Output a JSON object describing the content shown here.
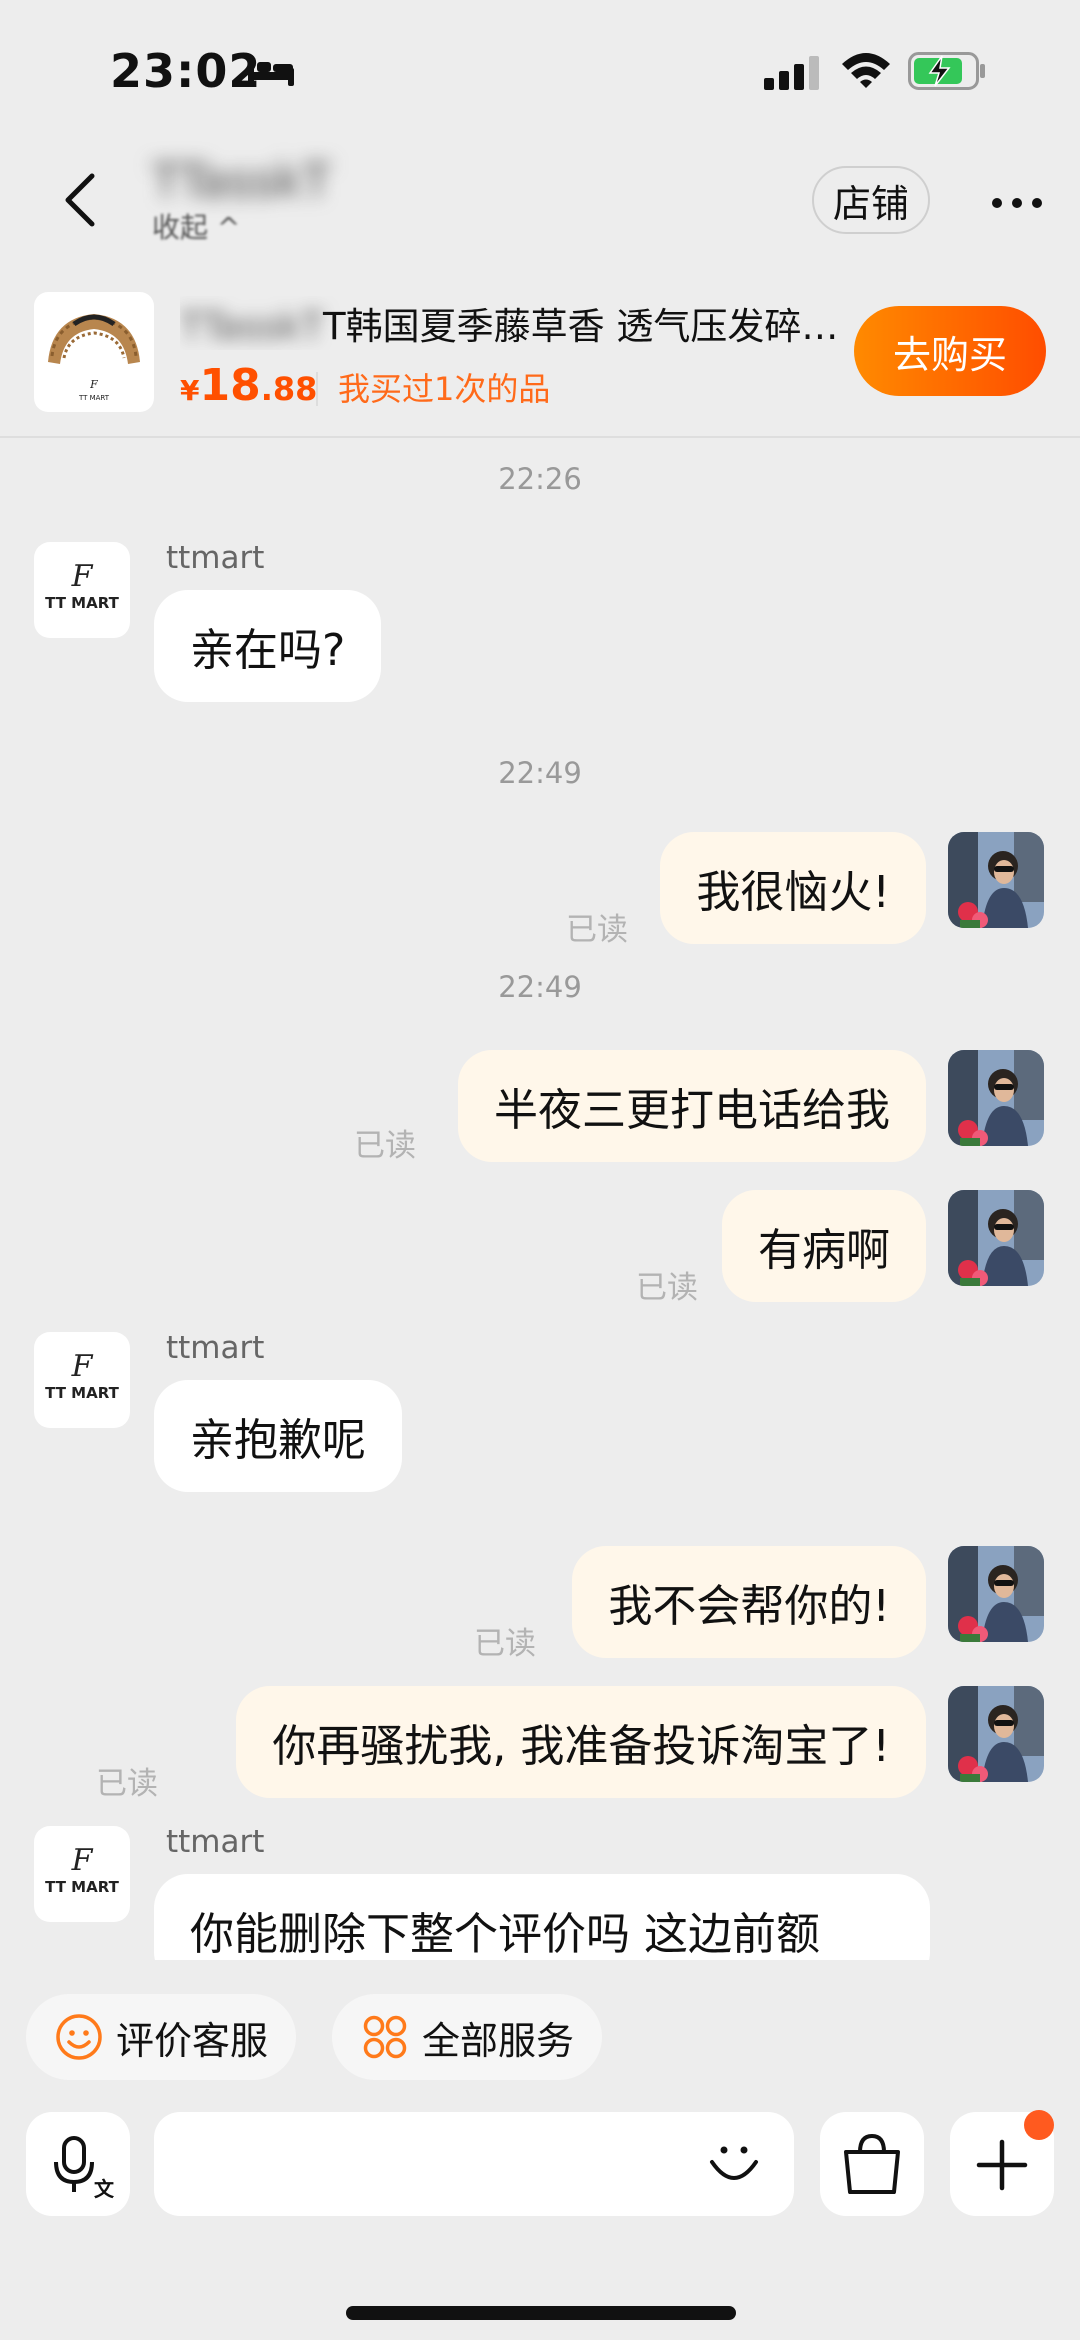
{
  "status_bar": {
    "time": "23:02",
    "battery_color": "#34c759"
  },
  "header": {
    "shop_name": "TTasskT",
    "shop_sub": "收起 ^",
    "store_label": "店铺"
  },
  "product": {
    "title_blurred": "TTasskT",
    "title": "T韩国夏季藤草香 透气压发碎…",
    "price_currency": "¥",
    "price_int": "18",
    "price_dec": ".88",
    "bought_note": "我买过1次的品",
    "thumb_brand": "TT MART",
    "buy_label": "去购买"
  },
  "chat": {
    "shop_avatar_text": "TT MART",
    "messages": [
      {
        "type": "time",
        "text": "22:26"
      },
      {
        "type": "in",
        "sender": "ttmart",
        "text": "亲在吗?"
      },
      {
        "type": "time",
        "text": "22:49"
      },
      {
        "type": "out",
        "text": "我很恼火!",
        "read": "已读"
      },
      {
        "type": "time",
        "text": "22:49"
      },
      {
        "type": "out",
        "text": "半夜三更打电话给我",
        "read": "已读"
      },
      {
        "type": "out",
        "text": "有病啊",
        "read": "已读"
      },
      {
        "type": "in",
        "sender": "ttmart",
        "text": "亲抱歉呢"
      },
      {
        "type": "out",
        "text": "我不会帮你的!",
        "read": "已读"
      },
      {
        "type": "out",
        "text": "你再骚扰我, 我准备投诉淘宝了!",
        "read": "已读"
      },
      {
        "type": "in",
        "sender": "ttmart",
        "text": "你能删除下整个评价吗 这边前额"
      }
    ]
  },
  "quick_actions": [
    {
      "label": "评价客服",
      "icon": "smiley-icon"
    },
    {
      "label": "全部服务",
      "icon": "grid-icon"
    }
  ],
  "input": {
    "placeholder": ""
  },
  "accent_color": "#ff5000"
}
